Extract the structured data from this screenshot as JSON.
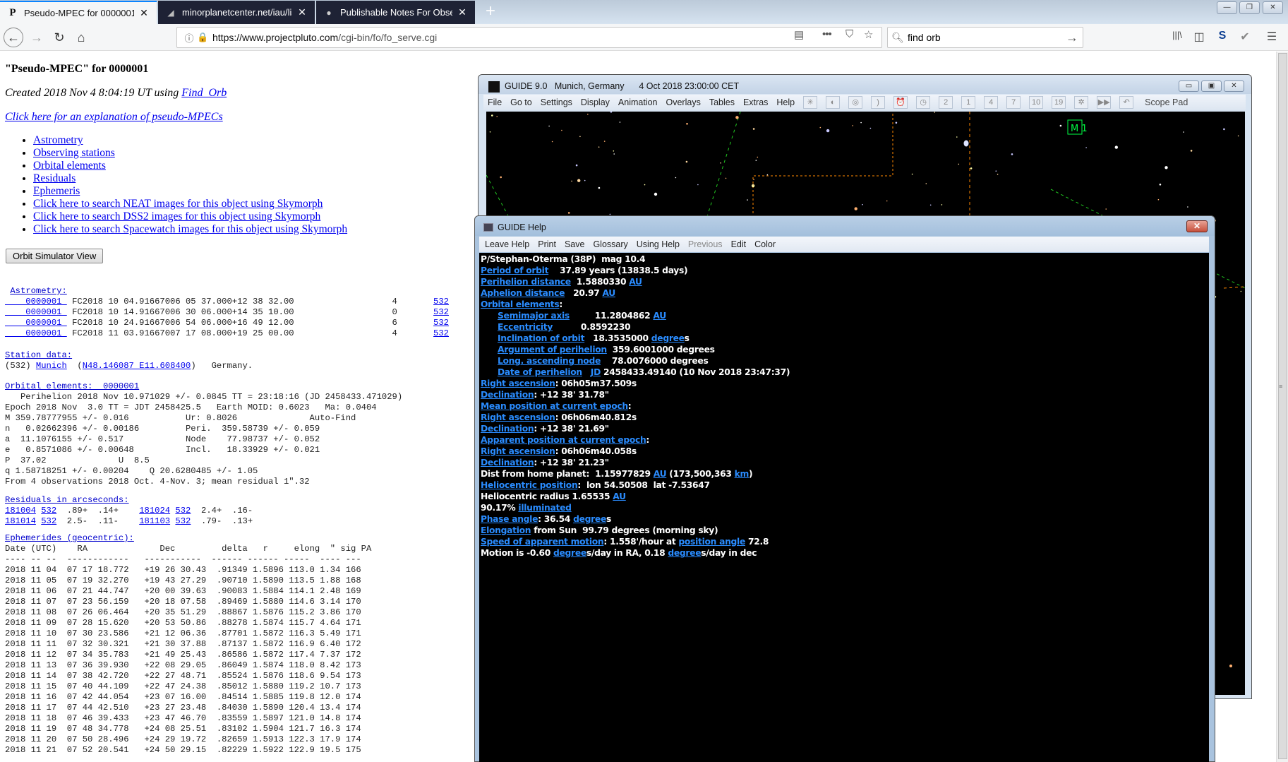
{
  "browser": {
    "tabs": [
      {
        "title": "Pseudo-MPEC for 0000001",
        "active": true,
        "favicon": "projectpluto-icon"
      },
      {
        "title": "minorplanetcenter.net/iau/lists",
        "active": false,
        "favicon": "mpc-icon"
      },
      {
        "title": "Publishable Notes For Observat",
        "active": false,
        "favicon": "mpc-notes-icon"
      }
    ],
    "new_tab": "+",
    "url_host": "https://www.projectpluto.com",
    "url_path": "/cgi-bin/fo/fo_serve.cgi",
    "search_value": "find orb",
    "search_placeholder": "Search",
    "window_controls": {
      "minimize": "—",
      "restore": "❐",
      "close": "✕"
    },
    "nav": {
      "back": "←",
      "forward": "→",
      "reload": "↻",
      "home": "⌂"
    },
    "toolbar_icons": {
      "reader": "▤",
      "more": "•••",
      "pocket": "⛉",
      "bookmark": "☆",
      "library": "|||\\",
      "sidebar": "◫",
      "sync": "S",
      "extension": "✔",
      "menu": "☰"
    }
  },
  "page": {
    "heading": "\"Pseudo-MPEC\" for 0000001",
    "created_prefix": "Created 2018 Nov 4 8:04:19 UT using ",
    "created_link": "Find_Orb",
    "explain_link": "Click here for an explanation of pseudo-MPECs",
    "links": [
      "Astrometry",
      "Observing stations",
      "Orbital elements",
      "Residuals",
      "Ephemeris",
      "Click here to search NEAT images for this object using Skymorph",
      "Click here to search DSS2 images for this object using Skymorph",
      "Click here to search Spacewatch images for this object using Skymorph"
    ],
    "orbit_button": "Orbit Simulator View",
    "astrometry": {
      "title": "Astrometry:",
      "rows": [
        {
          "id": "0000001",
          "data": "FC2018 10 04.91667006 05 37.000+12 38 32.00",
          "mag": "4",
          "code": "532"
        },
        {
          "id": "0000001",
          "data": "FC2018 10 14.91667006 30 06.000+14 35 10.00",
          "mag": "0",
          "code": "532"
        },
        {
          "id": "0000001",
          "data": "FC2018 10 24.91667006 54 06.000+16 49 12.00",
          "mag": "6",
          "code": "532"
        },
        {
          "id": "0000001",
          "data": "FC2018 11 03.91667007 17 08.000+19 25 00.00",
          "mag": "4",
          "code": "532"
        }
      ]
    },
    "station": {
      "title": "Station data:",
      "code": "(532)",
      "name": "Munich",
      "coords": "N48.146087 E11.608400",
      "country": "Germany."
    },
    "orbital": {
      "title": "Orbital elements:",
      "object": "0000001",
      "lines": [
        "   Perihelion 2018 Nov 10.971029 +/- 0.0845 TT = 23:18:16 (JD 2458433.471029)",
        "Epoch 2018 Nov  3.0 TT = JDT 2458425.5   Earth MOID: 0.6023   Ma: 0.0404",
        "M 359.78777955 +/- 0.016           Ur: 0.8026              Auto-Find",
        "n   0.02662396 +/- 0.00186         Peri.  359.58739 +/- 0.059",
        "a  11.1076155 +/- 0.517            Node    77.98737 +/- 0.052",
        "e   0.8571086 +/- 0.00648          Incl.   18.33929 +/- 0.021",
        "P  37.02              U  8.5",
        "q 1.58718251 +/- 0.00204    Q 20.6280485 +/- 1.05",
        "From 4 observations 2018 Oct. 4-Nov. 3; mean residual 1\".32"
      ]
    },
    "residuals": {
      "title": "Residuals in arcseconds:",
      "rows": [
        [
          {
            "date": "181004",
            "code": "532",
            "vals": ".89+  .14+"
          },
          {
            "date": "181024",
            "code": "532",
            "vals": "2.4+  .16-"
          }
        ],
        [
          {
            "date": "181014",
            "code": "532",
            "vals": "2.5-  .11-"
          },
          {
            "date": "181103",
            "code": "532",
            "vals": ".79-  .13+"
          }
        ]
      ]
    },
    "ephemerides": {
      "title": "Ephemerides (geocentric):",
      "header": "Date (UTC)    RA              Dec         delta   r     elong  \" sig PA",
      "dashes": "---- -- --  ------------   -----------  ------ ------ -----  ---- ---",
      "rows": [
        "2018 11 04  07 17 18.772   +19 26 30.43  .91349 1.5896 113.0 1.34 166",
        "2018 11 05  07 19 32.270   +19 43 27.29  .90710 1.5890 113.5 1.88 168",
        "2018 11 06  07 21 44.747   +20 00 39.63  .90083 1.5884 114.1 2.48 169",
        "2018 11 07  07 23 56.159   +20 18 07.58  .89469 1.5880 114.6 3.14 170",
        "2018 11 08  07 26 06.464   +20 35 51.29  .88867 1.5876 115.2 3.86 170",
        "2018 11 09  07 28 15.620   +20 53 50.86  .88278 1.5874 115.7 4.64 171",
        "2018 11 10  07 30 23.586   +21 12 06.36  .87701 1.5872 116.3 5.49 171",
        "2018 11 11  07 32 30.321   +21 30 37.88  .87137 1.5872 116.9 6.40 172",
        "2018 11 12  07 34 35.783   +21 49 25.43  .86586 1.5872 117.4 7.37 172",
        "2018 11 13  07 36 39.930   +22 08 29.05  .86049 1.5874 118.0 8.42 173",
        "2018 11 14  07 38 42.720   +22 27 48.71  .85524 1.5876 118.6 9.54 173",
        "2018 11 15  07 40 44.109   +22 47 24.38  .85012 1.5880 119.2 10.7 173",
        "2018 11 16  07 42 44.054   +23 07 16.00  .84514 1.5885 119.8 12.0 174",
        "2018 11 17  07 44 42.510   +23 27 23.48  .84030 1.5890 120.4 13.4 174",
        "2018 11 18  07 46 39.433   +23 47 46.70  .83559 1.5897 121.0 14.8 174",
        "2018 11 19  07 48 34.778   +24 08 25.51  .83102 1.5904 121.7 16.3 174",
        "2018 11 20  07 50 28.496   +24 29 19.72  .82659 1.5913 122.3 17.9 174",
        "2018 11 21  07 52 20.541   +24 50 29.15  .82229 1.5922 122.9 19.5 175"
      ]
    }
  },
  "guide": {
    "title": "GUIDE 9.0   Munich, Germany      4 Oct 2018 23:00:00 CET",
    "menus": [
      "File",
      "Go to",
      "Settings",
      "Display",
      "Animation",
      "Overlays",
      "Tables",
      "Extras",
      "Help"
    ],
    "tools": [
      {
        "name": "star-icon",
        "glyph": "✳"
      },
      {
        "name": "planet-icon",
        "glyph": "◐"
      },
      {
        "name": "target-icon",
        "glyph": "◎"
      },
      {
        "name": "moon-icon",
        "glyph": ")"
      },
      {
        "name": "alarm-clock-icon",
        "glyph": "⏰"
      },
      {
        "name": "time-screen-icon",
        "glyph": "◷"
      },
      {
        "name": "zoom-2-icon",
        "glyph": "2"
      },
      {
        "name": "zoom-1-icon",
        "glyph": "1"
      },
      {
        "name": "zoom-4-icon",
        "glyph": "4"
      },
      {
        "name": "zoom-7-icon",
        "glyph": "7"
      },
      {
        "name": "zoom-10-icon",
        "glyph": "10"
      },
      {
        "name": "nineteen-icon",
        "glyph": "19"
      },
      {
        "name": "telescope-icon",
        "glyph": "✲"
      },
      {
        "name": "fast-forward-icon",
        "glyph": "▶▶"
      },
      {
        "name": "undo-icon",
        "glyph": "↶"
      }
    ],
    "scope_pad": "Scope Pad",
    "map_label": "M 1",
    "map_colors": {
      "background": "#000000",
      "constellation_line": "#22cc22",
      "boundary": "#ff8800",
      "label": "#00ff44"
    }
  },
  "help": {
    "title": "GUIDE Help",
    "menus": [
      {
        "label": "Leave Help",
        "disabled": false
      },
      {
        "label": "Print",
        "disabled": false
      },
      {
        "label": "Save",
        "disabled": false
      },
      {
        "label": "Glossary",
        "disabled": false
      },
      {
        "label": "Using Help",
        "disabled": false
      },
      {
        "label": "Previous",
        "disabled": true
      },
      {
        "label": "Edit",
        "disabled": false
      },
      {
        "label": "Color",
        "disabled": false
      }
    ],
    "link_color": "#2a8cff",
    "lines": [
      {
        "indent": false,
        "parts": [
          {
            "t": "P/Stephan-Oterma (38P)  mag 10.4"
          }
        ]
      },
      {
        "indent": false,
        "parts": [
          {
            "l": "Period of orbit"
          },
          {
            "t": "    37.89 years (13838.5 days)"
          }
        ]
      },
      {
        "indent": false,
        "parts": [
          {
            "l": "Perihelion distance"
          },
          {
            "t": "  1.5880330 "
          },
          {
            "l": "AU"
          }
        ]
      },
      {
        "indent": false,
        "parts": [
          {
            "l": "Aphelion distance"
          },
          {
            "t": "   20.97 "
          },
          {
            "l": "AU"
          }
        ]
      },
      {
        "indent": false,
        "parts": [
          {
            "l": "Orbital elements"
          },
          {
            "t": ":"
          }
        ]
      },
      {
        "indent": true,
        "parts": [
          {
            "l": "Semimajor axis"
          },
          {
            "t": "         11.2804862 "
          },
          {
            "l": "AU"
          }
        ]
      },
      {
        "indent": true,
        "parts": [
          {
            "l": "Eccentricity"
          },
          {
            "t": "          0.8592230"
          }
        ]
      },
      {
        "indent": true,
        "parts": [
          {
            "l": "Inclination of orbit"
          },
          {
            "t": "   18.3535000 "
          },
          {
            "l": "degree"
          },
          {
            "t": "s"
          }
        ]
      },
      {
        "indent": true,
        "parts": [
          {
            "l": "Argument of perihelion"
          },
          {
            "t": "  359.6001000 degrees"
          }
        ]
      },
      {
        "indent": true,
        "parts": [
          {
            "l": "Long. ascending node"
          },
          {
            "t": "    78.0076000 degrees"
          }
        ]
      },
      {
        "indent": true,
        "parts": [
          {
            "l": "Date of perihelion"
          },
          {
            "t": "   "
          },
          {
            "l": "JD"
          },
          {
            "t": " 2458433.49140 (10 Nov 2018 23:47:37)"
          }
        ]
      },
      {
        "indent": false,
        "parts": [
          {
            "l": "Right ascension"
          },
          {
            "t": ": 06h05m37.509s"
          }
        ]
      },
      {
        "indent": false,
        "parts": [
          {
            "l": "Declination"
          },
          {
            "t": ": +12 38' 31.78\""
          }
        ]
      },
      {
        "indent": false,
        "parts": [
          {
            "l": "Mean position at current epoch"
          },
          {
            "t": ":"
          }
        ]
      },
      {
        "indent": false,
        "parts": [
          {
            "l": "Right ascension"
          },
          {
            "t": ": 06h06m40.812s"
          }
        ]
      },
      {
        "indent": false,
        "parts": [
          {
            "l": "Declination"
          },
          {
            "t": ": +12 38' 21.69\""
          }
        ]
      },
      {
        "indent": false,
        "parts": [
          {
            "l": "Apparent position at current epoch"
          },
          {
            "t": ":"
          }
        ]
      },
      {
        "indent": false,
        "parts": [
          {
            "l": "Right ascension"
          },
          {
            "t": ": 06h06m40.058s"
          }
        ]
      },
      {
        "indent": false,
        "parts": [
          {
            "l": "Declination"
          },
          {
            "t": ": +12 38' 21.23\""
          }
        ]
      },
      {
        "indent": false,
        "parts": [
          {
            "t": "Dist from home planet:  1.15977829 "
          },
          {
            "l": "AU"
          },
          {
            "t": " (173,500,363 "
          },
          {
            "l": "km"
          },
          {
            "t": ")"
          }
        ]
      },
      {
        "indent": false,
        "parts": [
          {
            "l": "Heliocentric position"
          },
          {
            "t": ":  lon 54.50508  lat -7.53647"
          }
        ]
      },
      {
        "indent": false,
        "parts": [
          {
            "t": "Heliocentric radius 1.65535 "
          },
          {
            "l": "AU"
          }
        ]
      },
      {
        "indent": false,
        "parts": [
          {
            "t": "90.17% "
          },
          {
            "l": "illuminated"
          }
        ]
      },
      {
        "indent": false,
        "parts": [
          {
            "l": "Phase angle"
          },
          {
            "t": ": 36.54 "
          },
          {
            "l": "degree"
          },
          {
            "t": "s"
          }
        ]
      },
      {
        "indent": false,
        "parts": [
          {
            "l": "Elongation"
          },
          {
            "t": " from Sun  99.79 degrees (morning sky)"
          }
        ]
      },
      {
        "indent": false,
        "parts": [
          {
            "l": "Speed of apparent motion"
          },
          {
            "t": ": 1.558'/hour at "
          },
          {
            "l": "position angle"
          },
          {
            "t": " 72.8"
          }
        ]
      },
      {
        "indent": false,
        "parts": [
          {
            "t": "Motion is -0.60 "
          },
          {
            "l": "degree"
          },
          {
            "t": "s/day in RA, 0.18 "
          },
          {
            "l": "degree"
          },
          {
            "t": "s/day in dec"
          }
        ]
      }
    ]
  }
}
